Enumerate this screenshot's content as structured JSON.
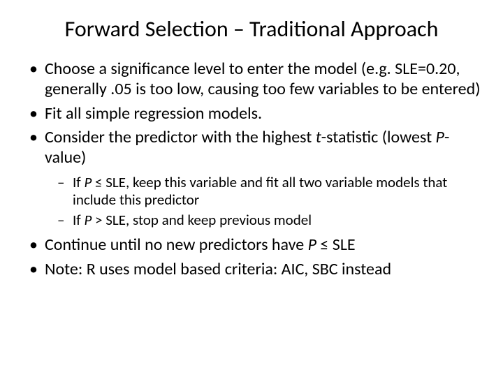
{
  "title": "Forward Selection – Traditional Approach",
  "bullets": {
    "b1a": "Choose a significance level to enter the model (e.g. SLE=0.20, generally .05 is too low, causing too few variables to be entered)",
    "b2": "Fit all simple regression models.",
    "b3a": "Consider the predictor with the highest ",
    "b3b": "t",
    "b3c": "-statistic (lowest ",
    "b3d": "P",
    "b3e": "-value)",
    "b4a": "Continue until no new predictors have ",
    "b4b": "P",
    "b4c": " ≤ SLE",
    "b5": "Note: R uses model based criteria: AIC, SBC instead"
  },
  "sub": {
    "s1a": "If ",
    "s1b": "P",
    "s1c": " ≤ SLE, keep this variable and fit all two variable models that include this predictor",
    "s2a": "If ",
    "s2b": "P",
    "s2c": " > SLE, stop and keep previous model"
  }
}
